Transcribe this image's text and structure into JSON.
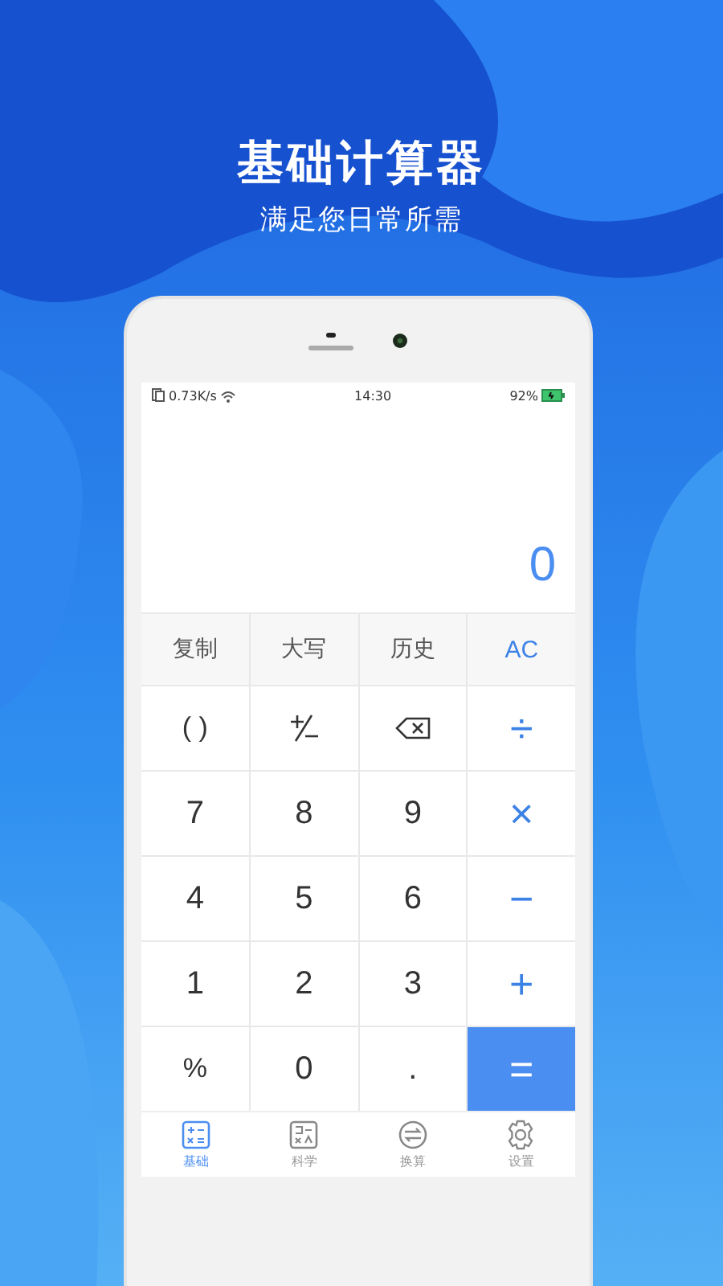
{
  "header": {
    "title": "基础计算器",
    "subtitle": "满足您日常所需"
  },
  "status_bar": {
    "network_speed": "0.73K/s",
    "time": "14:30",
    "battery": "92%"
  },
  "display": {
    "value": "0"
  },
  "keypad": {
    "rows": [
      [
        {
          "kind": "func",
          "label": "复制"
        },
        {
          "kind": "func",
          "label": "大写"
        },
        {
          "kind": "func",
          "label": "历史"
        },
        {
          "kind": "clear",
          "label": "AC"
        }
      ],
      [
        {
          "kind": "text",
          "label": "( )"
        },
        {
          "kind": "plusminus"
        },
        {
          "kind": "backspace"
        },
        {
          "kind": "op",
          "label": "÷"
        }
      ],
      [
        {
          "kind": "digit",
          "label": "7"
        },
        {
          "kind": "digit",
          "label": "8"
        },
        {
          "kind": "digit",
          "label": "9"
        },
        {
          "kind": "op",
          "label": "×"
        }
      ],
      [
        {
          "kind": "digit",
          "label": "4"
        },
        {
          "kind": "digit",
          "label": "5"
        },
        {
          "kind": "digit",
          "label": "6"
        },
        {
          "kind": "op",
          "label": "−"
        }
      ],
      [
        {
          "kind": "digit",
          "label": "1"
        },
        {
          "kind": "digit",
          "label": "2"
        },
        {
          "kind": "digit",
          "label": "3"
        },
        {
          "kind": "op",
          "label": "+"
        }
      ],
      [
        {
          "kind": "text",
          "label": "%"
        },
        {
          "kind": "digit",
          "label": "0"
        },
        {
          "kind": "digit",
          "label": "."
        },
        {
          "kind": "equals",
          "label": "="
        }
      ]
    ]
  },
  "tabs": [
    {
      "kind": "basic",
      "label": "基础",
      "selected": true
    },
    {
      "kind": "science",
      "label": "科学",
      "selected": false
    },
    {
      "kind": "convert",
      "label": "换算",
      "selected": false
    },
    {
      "kind": "settings",
      "label": "设置",
      "selected": false
    }
  ]
}
